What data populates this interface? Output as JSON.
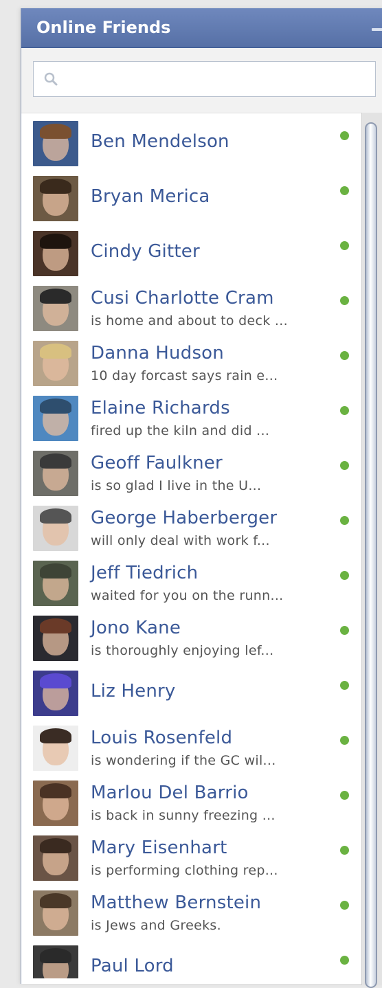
{
  "panel": {
    "title": "Online Friends",
    "minimize_icon": "minimize-icon"
  },
  "search": {
    "placeholder": "",
    "value": "",
    "icon": "search-icon"
  },
  "colors": {
    "header": "#5c75ab",
    "link": "#3b5998",
    "online_dot": "#6ab241"
  },
  "friends": [
    {
      "name": "Ben Mendelson",
      "status": ""
    },
    {
      "name": "Bryan Merica",
      "status": ""
    },
    {
      "name": "Cindy Gitter",
      "status": ""
    },
    {
      "name": "Cusi Charlotte Cram",
      "status": "is home and about to deck ..."
    },
    {
      "name": "Danna Hudson",
      "status": "10 day forcast says rain e..."
    },
    {
      "name": "Elaine Richards",
      "status": "fired up the kiln and did ..."
    },
    {
      "name": "Geoff Faulkner",
      "status": "is so glad I live in the U..."
    },
    {
      "name": "George Haberberger",
      "status": "will only deal with work f..."
    },
    {
      "name": "Jeff Tiedrich",
      "status": "waited for you on the runn..."
    },
    {
      "name": "Jono Kane",
      "status": "is thoroughly enjoying lef..."
    },
    {
      "name": "Liz Henry",
      "status": ""
    },
    {
      "name": "Louis Rosenfeld",
      "status": "is wondering if the GC wil..."
    },
    {
      "name": "Marlou Del Barrio",
      "status": "is back in sunny freezing ..."
    },
    {
      "name": "Mary Eisenhart",
      "status": "is performing clothing rep..."
    },
    {
      "name": "Matthew Bernstein",
      "status": "is Jews and Greeks."
    },
    {
      "name": "Paul Lord",
      "status": ""
    }
  ]
}
